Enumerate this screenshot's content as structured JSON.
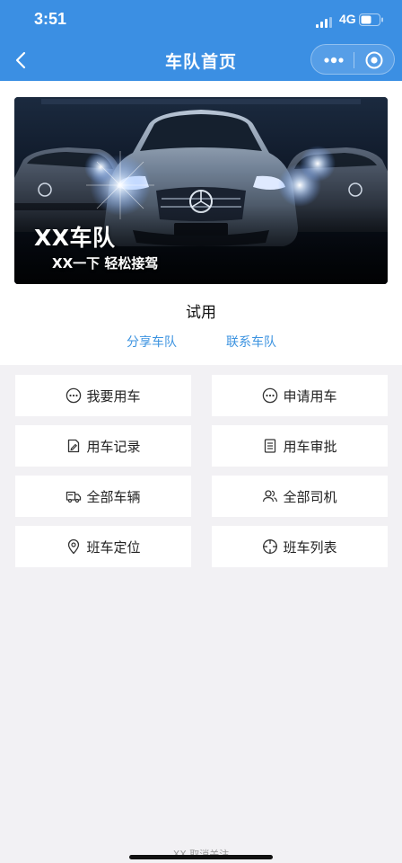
{
  "status_bar": {
    "time": "3:51",
    "network": "4G"
  },
  "nav": {
    "title": "车队首页"
  },
  "banner": {
    "brand": "XX车队",
    "slogan": "XX一下 轻松接驾"
  },
  "team": {
    "name": "试用"
  },
  "links": {
    "share": "分享车队",
    "contact": "联系车队"
  },
  "menu": [
    {
      "label": "我要用车",
      "icon": "more-circle-icon"
    },
    {
      "label": "申请用车",
      "icon": "more-circle-icon"
    },
    {
      "label": "用车记录",
      "icon": "edit-doc-icon"
    },
    {
      "label": "用车审批",
      "icon": "list-doc-icon"
    },
    {
      "label": "全部车辆",
      "icon": "truck-icon"
    },
    {
      "label": "全部司机",
      "icon": "users-icon"
    },
    {
      "label": "班车定位",
      "icon": "location-pin-icon"
    },
    {
      "label": "班车列表",
      "icon": "crosshair-icon"
    }
  ],
  "footer": {
    "text": "XX 取消关注"
  },
  "colors": {
    "primary": "#3b8fe3",
    "link": "#3c93e0",
    "page_bg": "#f2f1f4"
  }
}
